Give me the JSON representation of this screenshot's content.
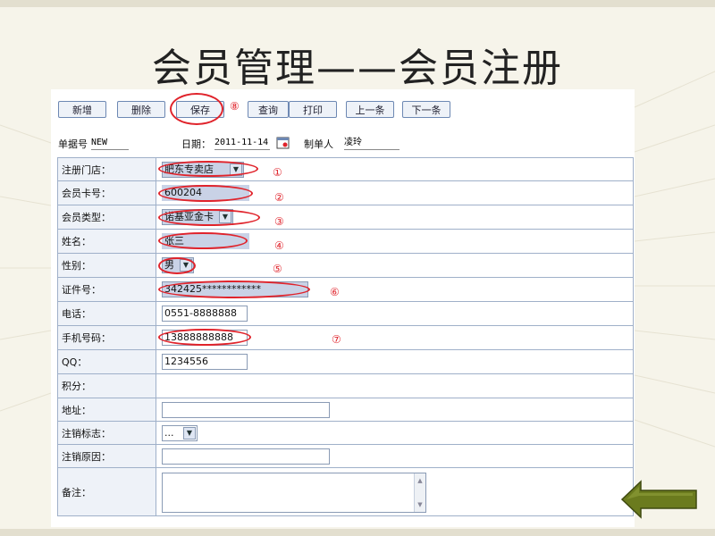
{
  "slide_title": "会员管理——会员注册",
  "toolbar": {
    "new": "新增",
    "delete": "删除",
    "save": "保存",
    "query": "查询",
    "print": "打印",
    "prev": "上一条",
    "next": "下一条"
  },
  "header": {
    "doc_no_label": "单据号",
    "doc_no_value": "NEW",
    "date_label": "日期：",
    "date_value": "2011-11-14",
    "creator_label": "制单人",
    "creator_value": "凌玲"
  },
  "form": {
    "store_label": "注册门店：",
    "store_value": "肥东专卖店",
    "card_no_label": "会员卡号：",
    "card_no_value": "600204",
    "member_type_label": "会员类型：",
    "member_type_value": "诺基亚金卡",
    "name_label": "姓名：",
    "name_value": "张三",
    "gender_label": "性别：",
    "gender_value": "男",
    "id_no_label": "证件号：",
    "id_no_value": "342425************",
    "phone_label": "电话：",
    "phone_value": "0551-8888888",
    "mobile_label": "手机号码：",
    "mobile_value": "13888888888",
    "qq_label": "QQ：",
    "qq_value": "1234556",
    "points_label": "积分：",
    "points_value": "",
    "address_label": "地址：",
    "address_value": "",
    "cancel_flag_label": "注销标志：",
    "cancel_flag_value": "...",
    "cancel_reason_label": "注销原因：",
    "cancel_reason_value": "",
    "remark_label": "备注：",
    "remark_value": ""
  },
  "annotations": {
    "n1": "①",
    "n2": "②",
    "n3": "③",
    "n4": "④",
    "n5": "⑤",
    "n6": "⑥",
    "n7": "⑦",
    "n8": "⑧",
    "color": "#e0232b"
  },
  "colors": {
    "accent_border": "#6d88b3",
    "filled_field": "#c9d2e6",
    "arrow_green": "#6b7b1e"
  }
}
